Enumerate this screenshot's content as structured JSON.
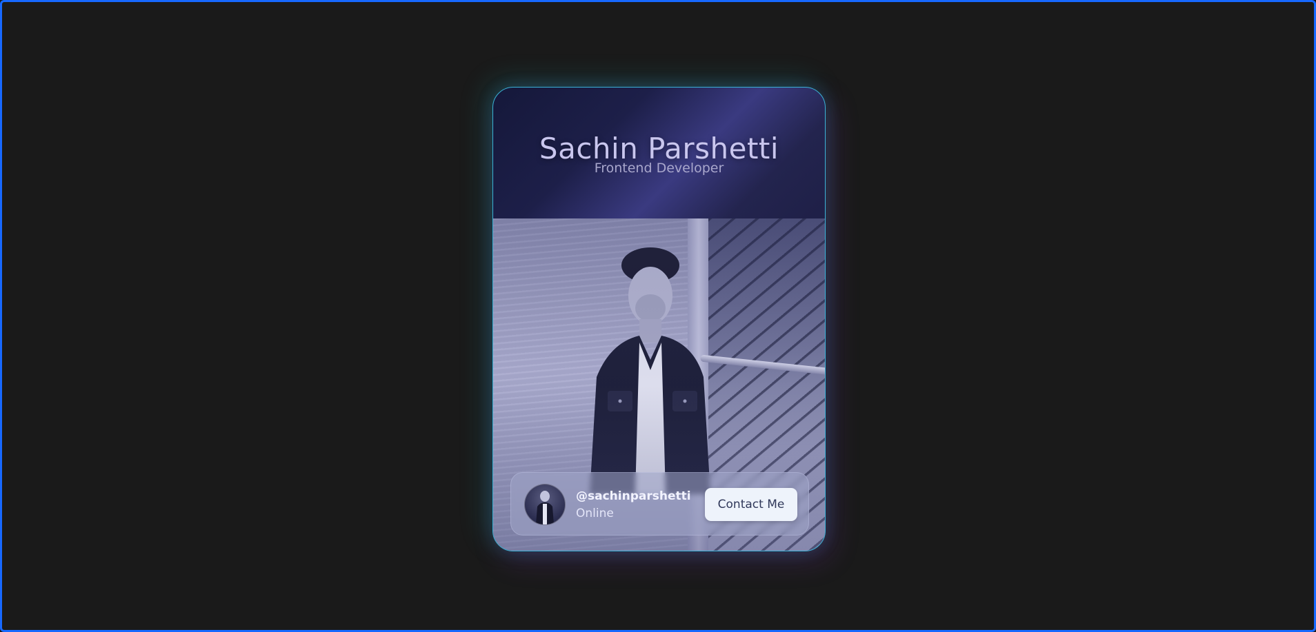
{
  "profile": {
    "name": "Sachin Parshetti",
    "role": "Frontend Developer",
    "handle": "@sachinparshetti",
    "status": "Online",
    "contact_label": "Contact Me"
  },
  "colors": {
    "frame_border": "#1769ff",
    "page_background": "#1a1a1a",
    "card_border": "#3bb3d8",
    "button_background": "#eef3fb"
  },
  "icons": {
    "avatar": "profile-avatar-photo",
    "photo": "profile-portrait-photo"
  }
}
